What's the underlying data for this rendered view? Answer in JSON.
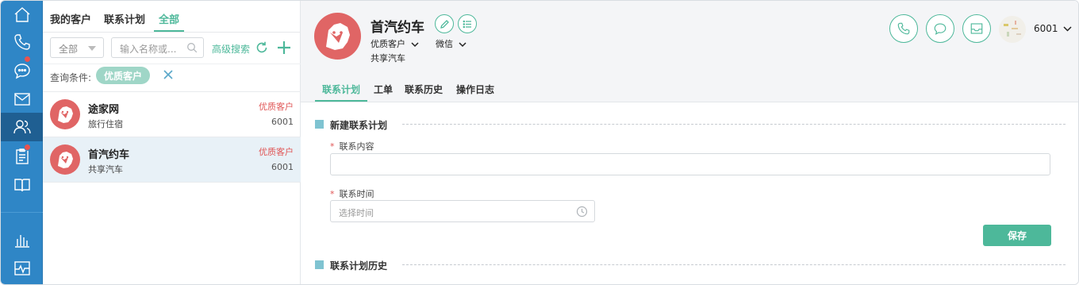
{
  "colors": {
    "rail": "#2f86c6",
    "accent": "#4db89a",
    "danger": "#e05555",
    "avatar": "#e06565"
  },
  "rail": {
    "items": [
      {
        "name": "home-icon",
        "active": false,
        "badge": false
      },
      {
        "name": "phone-icon",
        "active": false,
        "badge": false
      },
      {
        "name": "chat-icon",
        "active": false,
        "badge": true
      },
      {
        "name": "mail-icon",
        "active": false,
        "badge": false
      },
      {
        "name": "customers-icon",
        "active": true,
        "badge": false
      },
      {
        "name": "tasks-icon",
        "active": false,
        "badge": true
      },
      {
        "name": "book-icon",
        "active": false,
        "badge": false
      },
      {
        "name": "stats-icon",
        "active": false,
        "badge": false
      },
      {
        "name": "monitor-icon",
        "active": false,
        "badge": false
      }
    ]
  },
  "list": {
    "tabs": [
      "我的客户",
      "联系计划",
      "全部"
    ],
    "active_tab": "全部",
    "filter": {
      "select_value": "全部",
      "search_placeholder": "输入名称或...",
      "advanced_label": "高级搜索"
    },
    "condition": {
      "label": "查询条件:",
      "tag": "优质客户"
    },
    "customers": [
      {
        "name": "途家网",
        "sub": "旅行住宿",
        "tag": "优质客户",
        "number": "6001",
        "selected": false
      },
      {
        "name": "首汽约车",
        "sub": "共享汽车",
        "tag": "优质客户",
        "number": "6001",
        "selected": true
      }
    ]
  },
  "detail": {
    "name": "首汽约车",
    "level": "优质客户",
    "channel": "微信",
    "company": "共享汽车",
    "agent_number": "6001",
    "tabs": [
      "联系计划",
      "工单",
      "联系历史",
      "操作日志"
    ],
    "active_tab": "联系计划",
    "new_plan": {
      "title": "新建联系计划",
      "content_label": "联系内容",
      "time_label": "联系时间",
      "time_placeholder": "选择时间",
      "save_label": "保存"
    },
    "history_title": "联系计划历史"
  }
}
